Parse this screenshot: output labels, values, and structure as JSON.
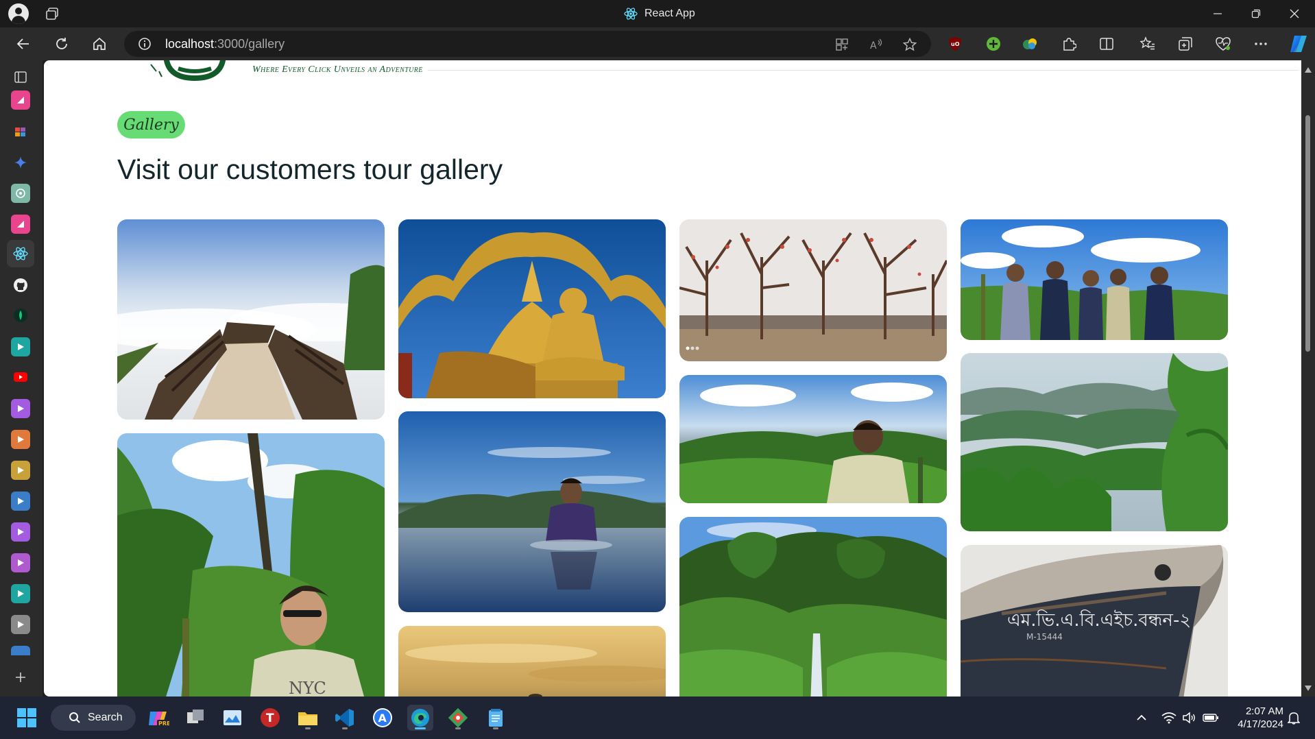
{
  "window": {
    "title": "React App"
  },
  "address_bar": {
    "host": "localhost",
    "path": ":3000/gallery"
  },
  "site": {
    "tagline": "Where Every Click Unveils an Adventure"
  },
  "page": {
    "badge": "Gallery",
    "heading": "Visit our customers tour gallery"
  },
  "gallery": {
    "photos": [
      "viewpoint-above-clouds",
      "golden-buddha-temple",
      "silk-cotton-tree-garden",
      "group-of-friends-hilltop",
      "man-in-forest-with-sunglasses",
      "man-sitting-in-river",
      "man-overlooking-green-hills",
      "misty-green-hills",
      "sunset-sky",
      "waterfall-in-jungle",
      "rusty-ship-hull"
    ]
  },
  "taskbar": {
    "search_label": "Search",
    "time": "2:07 AM",
    "date": "4/17/2024"
  },
  "colors": {
    "badge_bg": "#67dc74",
    "heading": "#13262b",
    "tagline": "#135a2a",
    "taskbar_bg": "#1e2433",
    "chrome_bg": "#2b2b2b"
  }
}
